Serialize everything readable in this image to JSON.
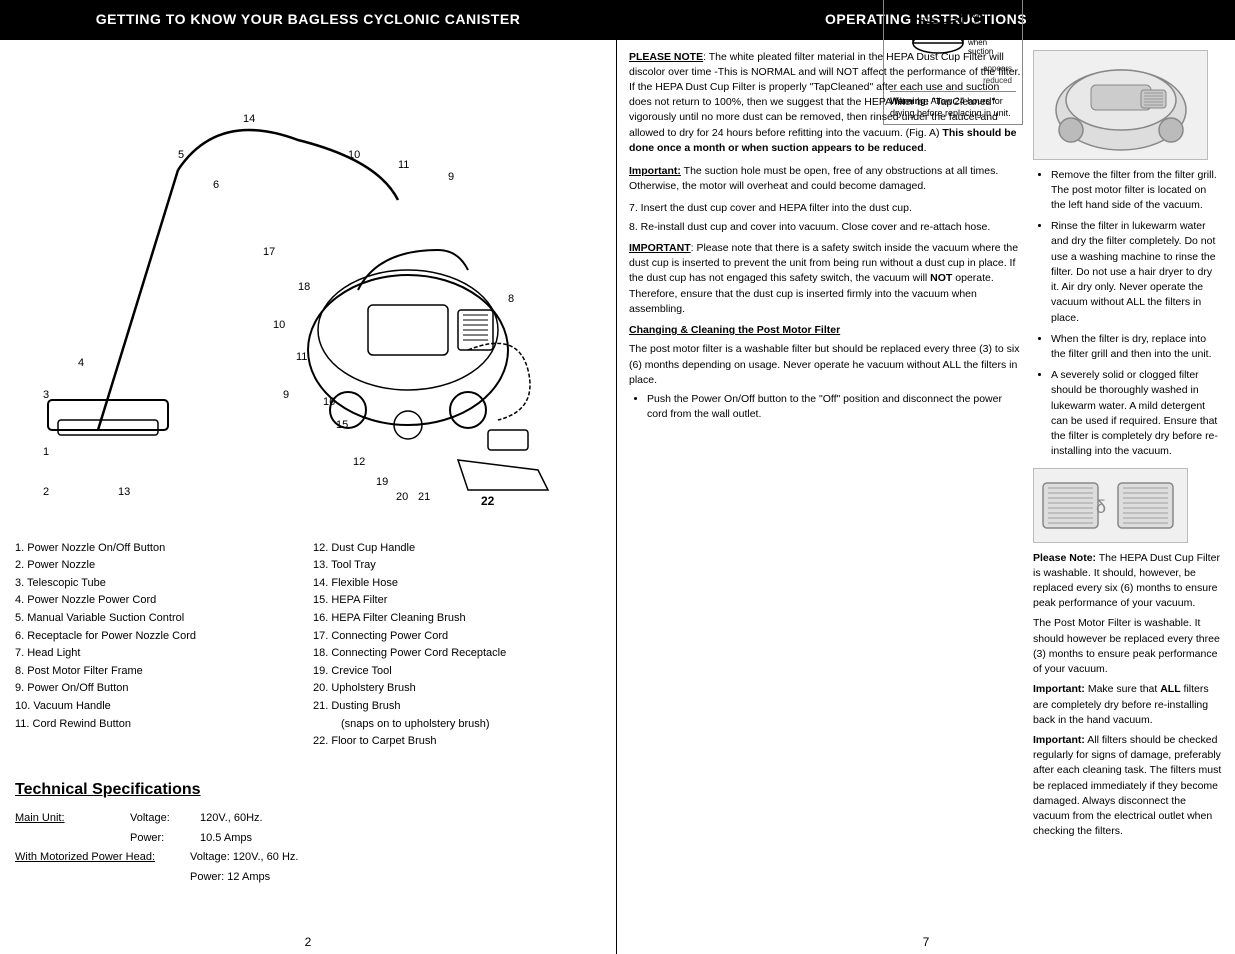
{
  "left": {
    "header": "GETTING TO KNOW  YOUR BAGLESS CYCLONIC CANISTER",
    "parts": {
      "col1": [
        {
          "num": "1.",
          "text": "Power Nozzle On/Off Button"
        },
        {
          "num": "2.",
          "text": "Power Nozzle"
        },
        {
          "num": "3.",
          "text": "Telescopic Tube"
        },
        {
          "num": "4.",
          "text": "Power Nozzle Power Cord"
        },
        {
          "num": "5.",
          "text": "Manual Variable Suction Control"
        },
        {
          "num": "6.",
          "text": "Receptacle for Power Nozzle Cord"
        },
        {
          "num": "7.",
          "text": "Head Light"
        },
        {
          "num": "8.",
          "text": "Post Motor Filter Frame"
        },
        {
          "num": "9.",
          "text": "Power On/Off Button"
        },
        {
          "num": "10.",
          "text": "Vacuum Handle"
        },
        {
          "num": "11.",
          "text": "Cord Rewind Button"
        }
      ],
      "col2": [
        {
          "num": "12.",
          "text": "Dust Cup Handle"
        },
        {
          "num": "13.",
          "text": "Tool Tray"
        },
        {
          "num": "14.",
          "text": "Flexible Hose"
        },
        {
          "num": "15.",
          "text": "HEPA Filter"
        },
        {
          "num": "16.",
          "text": "HEPA Filter Cleaning Brush"
        },
        {
          "num": "17.",
          "text": "Connecting Power Cord"
        },
        {
          "num": "18.",
          "text": "Connecting Power Cord Receptacle"
        },
        {
          "num": "19.",
          "text": "Crevice Tool"
        },
        {
          "num": "20.",
          "text": "Upholstery Brush"
        },
        {
          "num": "21.",
          "text": "Dusting Brush"
        },
        {
          "num": "21_note",
          "text": "(snaps on to upholstery brush)"
        },
        {
          "num": "22.",
          "text": "Floor to Carpet Brush"
        }
      ]
    },
    "tech_specs": {
      "heading": "Technical Specifications",
      "rows": [
        {
          "label": "Main Unit:",
          "sub": "Voltage:",
          "val": "120V.,  60Hz."
        },
        {
          "label": "",
          "sub": "Power:",
          "val": "10.5 Amps"
        },
        {
          "label": "With Motorized Power Head:",
          "sub": "Voltage: 120V., 60 Hz.",
          "val": ""
        },
        {
          "label": "",
          "sub": "Power:  12 Amps",
          "val": ""
        }
      ]
    },
    "page_num": "2"
  },
  "right": {
    "header": "OPERATING INSTRUCTIONS",
    "please_note_label": "PLEASE NOTE",
    "please_note_text": ": The white pleated filter material in the HEPA Dust Cup Filter will discolor over time -This is NORMAL and will NOT affect the performance of the filter. If the HEPA Dust Cup Filter is properly \"TapCleaned\" after each use and suction does not return to 100%, then we suggest that the HEPA filter be \"TapCleaned\" vigorously until no more dust can be removed, then rinsed under the faucet and allowed to dry for 24 hours before refitting into the vacuum. (Fig. A)",
    "please_note_bold": " This should be done once a month or when suction appears to be reduced",
    "please_note_end": ".",
    "fig_a": {
      "title": "Fig. A",
      "instruction": "Wash once a month or when suction appears reduced",
      "warning_label": "Warning:",
      "warning_text": " Allow 24 hours for drying before replacing in unit."
    },
    "important1_label": "Important:",
    "important1_text": " The suction hole must be open, free of any obstructions at all times.  Otherwise, the motor will overheat and could become damaged.",
    "step7": "7.  Insert the dust cup cover and HEPA filter into the dust cup.",
    "step8": "8.  Re-install dust cup and cover into vacuum. Close cover and re-attach hose.",
    "important2_label": "IMPORTANT",
    "important2_text": ": Please note that there is a safety switch inside the vacuum where the dust cup is inserted to prevent the unit from being run without a dust cup in place.  If the dust cup has not engaged this safety switch, the vacuum will ",
    "important2_bold": "NOT",
    "important2_text2": " operate. Therefore, ensure that the dust cup is inserted firmly into the vacuum when assembling.",
    "changing_heading": "Changing & Cleaning the Post Motor Filter",
    "changing_text": "The post motor filter is a washable filter but should be replaced every three (3) to six (6) months depending on usage. Never operate he vacuum without ALL the filters in place.",
    "bullet_step1": "Push the Power On/Off button to the \"Off\" position and disconnect the power cord from the wall outlet.",
    "right_bullets": [
      "Remove the filter from the filter grill. The post motor filter is located on the left hand side of the vacuum.",
      "Rinse the filter in lukewarm water and dry the filter completely. Do not use a washing machine to rinse the filter. Do not use a hair dryer to dry it. Air dry only. Never operate the vacuum without ALL the filters in place.",
      "When the filter is dry, replace into the filter grill and then into the unit.",
      "A severely solid or clogged filter should be thoroughly washed in lukewarm water. A mild detergent can be used if required. Ensure that the filter is completely dry before re-installing into the vacuum."
    ],
    "please_note2_label": "Please Note:",
    "please_note2_text": " The HEPA Dust Cup Filter is washable.  It should, however, be replaced every six (6) months to ensure peak performance of your vacuum.",
    "post_motor_text": "The Post Motor Filter is washable. It should however be replaced every three (3) months to ensure peak performance of your vacuum.",
    "important3_label": "Important:",
    "important3_text": " Make sure that ",
    "important3_bold": "ALL",
    "important3_text2": " filters are completely dry before re-installing back in the hand vacuum.",
    "important4_label": "Important:",
    "important4_text": " All filters should be checked regularly for signs of damage, preferably after each cleaning task. The filters must be replaced immediately if they become damaged. Always disconnect the vacuum from the electrical outlet when checking the filters.",
    "page_num": "7"
  }
}
